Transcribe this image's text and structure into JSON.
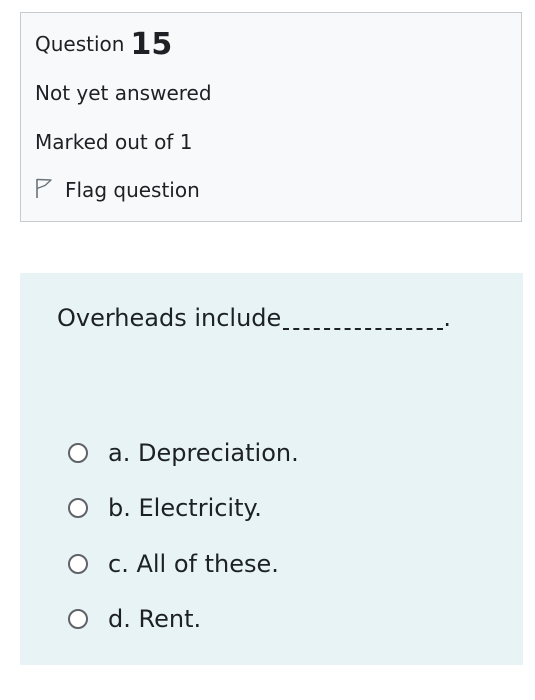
{
  "info": {
    "question_label": "Question",
    "question_number": "15",
    "state": "Not yet answered",
    "grade": "Marked out of 1",
    "flag_label": "Flag question"
  },
  "question": {
    "text": "Overheads include",
    "end_punct": ".",
    "options": [
      {
        "label": "a. Depreciation."
      },
      {
        "label": "b. Electricity."
      },
      {
        "label": "c. All of these."
      },
      {
        "label": "d. Rent."
      }
    ]
  },
  "colors": {
    "info_bg": "#f8f9fa",
    "info_border": "#c8cacc",
    "question_bg": "#e7f3f5",
    "text": "#1d2125"
  },
  "icons": {
    "flag": "flag-outline-icon",
    "radio": "radio-unchecked-icon"
  }
}
